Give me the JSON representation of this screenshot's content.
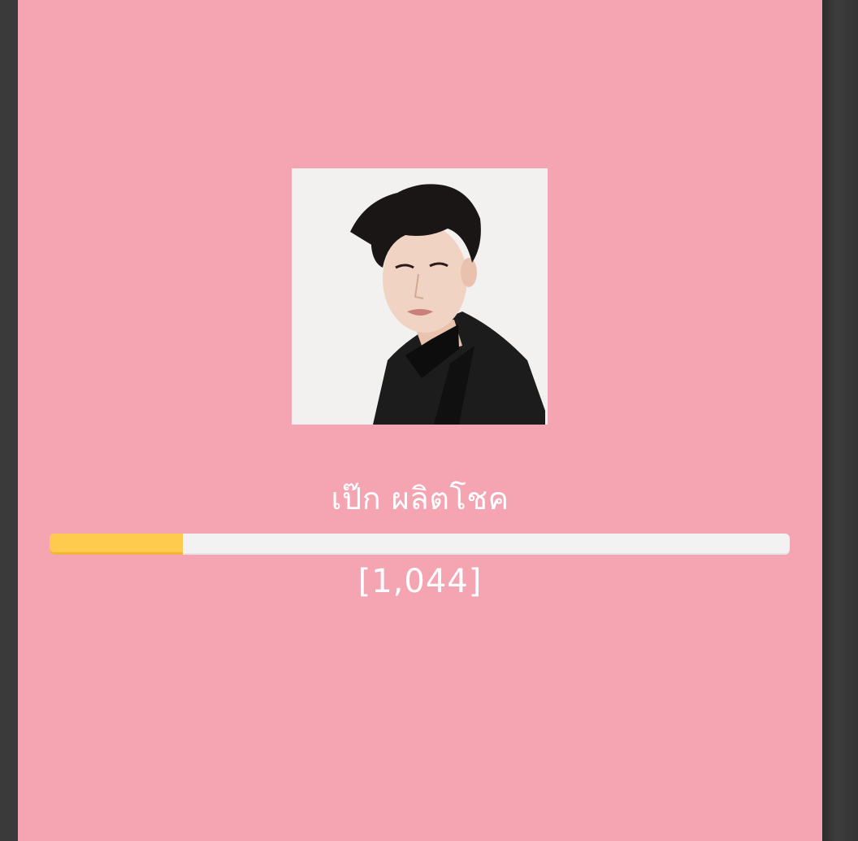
{
  "candidate": {
    "name": "เป๊ก ผลิตโชค",
    "votes_display": "[1,044]",
    "progress_fraction": 0.18,
    "photo_icon": "portrait-photo-icon"
  },
  "colors": {
    "background": "#f5a5b1",
    "bar_fill": "#ffcb4f",
    "bar_track": "#f2f2f2",
    "text": "#ffffff",
    "frame": "#3a3a3a"
  }
}
